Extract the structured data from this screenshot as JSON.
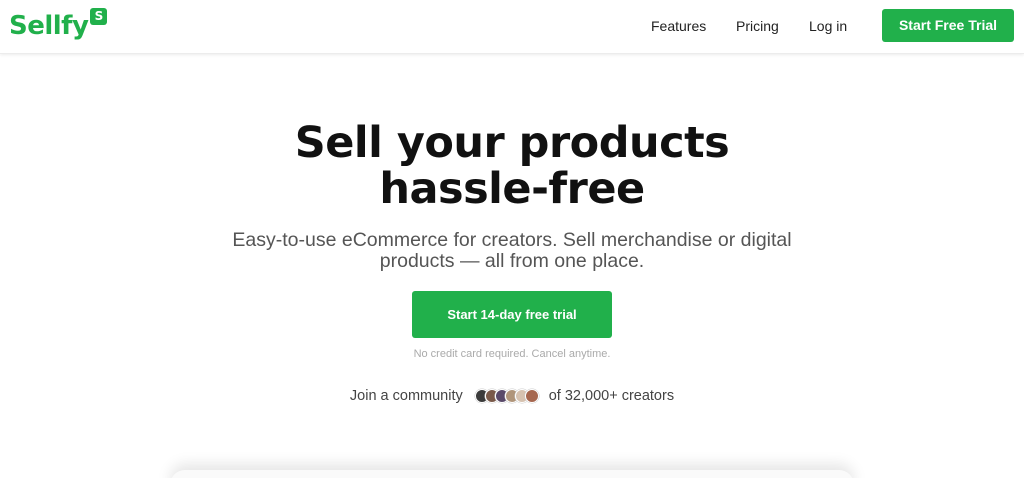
{
  "header": {
    "logo_text": "Sellfy",
    "logo_badge": "S",
    "nav": [
      {
        "label": "Features"
      },
      {
        "label": "Pricing"
      },
      {
        "label": "Log in"
      }
    ],
    "cta_label": "Start Free Trial"
  },
  "hero": {
    "title_line1": "Sell your products",
    "title_line2": "hassle-free",
    "subtitle_line1": "Easy-to-use eCommerce for creators. Sell merchandise or digital",
    "subtitle_line2": "products — all from one place.",
    "cta_label": "Start 14-day free trial",
    "note": "No credit card required. Cancel anytime.",
    "community_prefix": "Join a community",
    "community_suffix": "of 32,000+ creators"
  },
  "colors": {
    "brand_green": "#21b04b",
    "avatar_colors": [
      "#3b3b3b",
      "#7a5a4a",
      "#5a4a6a",
      "#b0957a",
      "#d6c2b0",
      "#a6674f"
    ]
  }
}
